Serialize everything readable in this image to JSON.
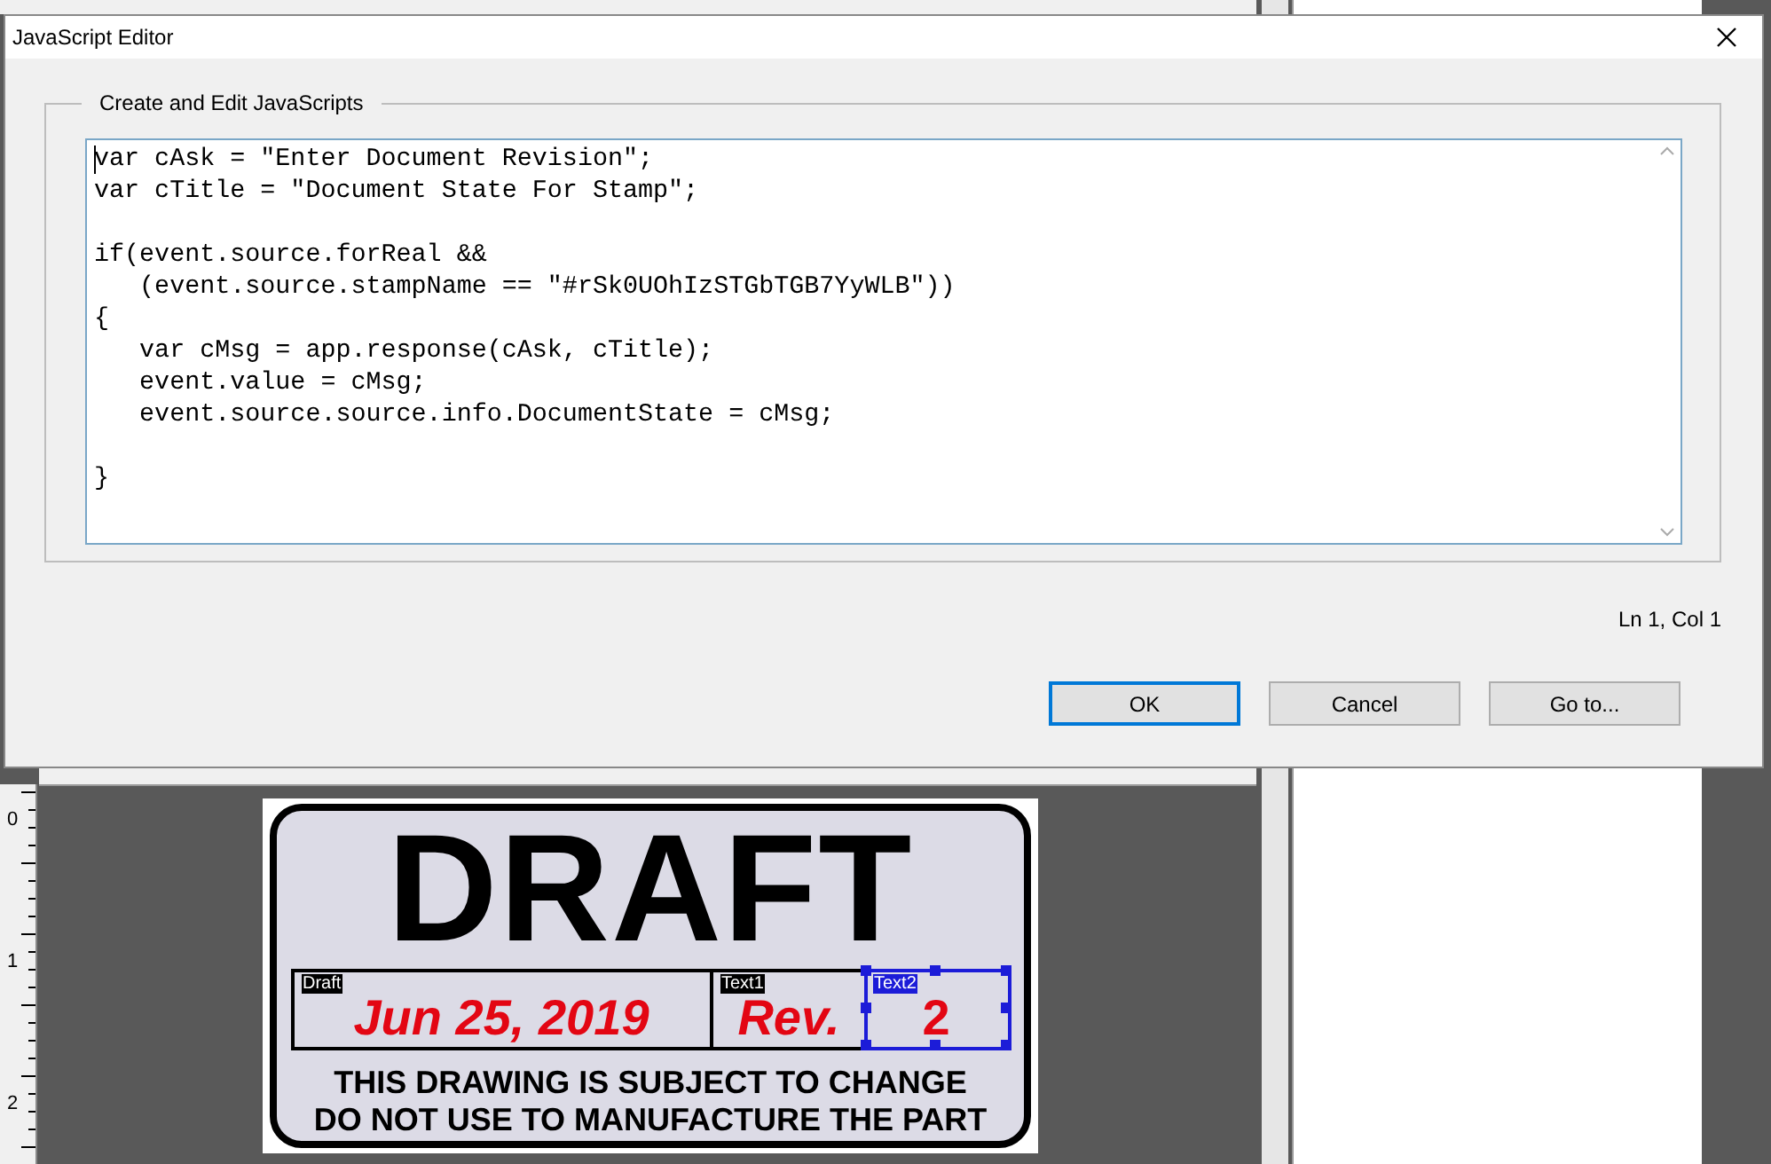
{
  "dialog": {
    "title": "JavaScript Editor",
    "group_label": "Create and Edit JavaScripts",
    "code": "var cAsk = \"Enter Document Revision\";\nvar cTitle = \"Document State For Stamp\";\n\nif(event.source.forReal &&\n   (event.source.stampName == \"#rSk0UOhIzSTGbTGB7YyWLB\"))\n{\n   var cMsg = app.response(cAsk, cTitle);\n   event.value = cMsg;\n   event.source.source.info.DocumentState = cMsg;\n\n}",
    "cursor_position": "Ln 1, Col 1",
    "buttons": [
      {
        "label": "OK",
        "default": true
      },
      {
        "label": "Cancel",
        "default": false
      },
      {
        "label": "Go to...",
        "default": false
      }
    ]
  },
  "ruler": {
    "ticks": [
      "0",
      "1",
      "2"
    ]
  },
  "stamp": {
    "title": "DRAFT",
    "date": "Jun 25, 2019",
    "rev_label": "Rev.",
    "rev": "2",
    "notice_lines": [
      "THIS DRAWING IS SUBJECT TO CHANGE",
      "DO NOT USE TO MANUFACTURE THE PART"
    ],
    "fields": [
      {
        "name": "Draft",
        "selected": false
      },
      {
        "name": "Text1",
        "selected": false
      },
      {
        "name": "Text2",
        "selected": true
      }
    ]
  }
}
